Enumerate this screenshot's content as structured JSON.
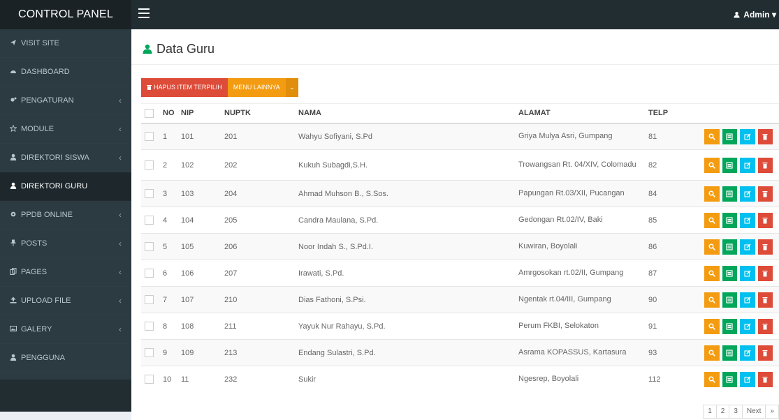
{
  "app": {
    "brand": "CONTROL PANEL",
    "user": "Admin"
  },
  "sidebar": {
    "items": [
      {
        "label": "VISIT SITE",
        "icon": "send-icon",
        "chevron": false
      },
      {
        "label": "DASHBOARD",
        "icon": "dashboard-icon",
        "chevron": false
      },
      {
        "label": "PENGATURAN",
        "icon": "cogs-icon",
        "chevron": true
      },
      {
        "label": "MODULE",
        "icon": "star-icon",
        "chevron": true
      },
      {
        "label": "DIREKTORI SISWA",
        "icon": "user-icon",
        "chevron": true
      },
      {
        "label": "DIREKTORI GURU",
        "icon": "user-icon",
        "chevron": false,
        "active": true
      },
      {
        "label": "PPDB ONLINE",
        "icon": "gear-icon",
        "chevron": true
      },
      {
        "label": "POSTS",
        "icon": "pushpin-icon",
        "chevron": true
      },
      {
        "label": "PAGES",
        "icon": "pages-icon",
        "chevron": true
      },
      {
        "label": "UPLOAD FILE",
        "icon": "upload-icon",
        "chevron": true
      },
      {
        "label": "GALERY",
        "icon": "image-icon",
        "chevron": true
      },
      {
        "label": "PENGGUNA",
        "icon": "user-icon",
        "chevron": false
      }
    ],
    "chevron_glyph": "‹"
  },
  "page": {
    "title": "Data Guru"
  },
  "toolbar": {
    "delete_label": "HAPUS ITEM TERPILIH",
    "more_label": "MENU LAINNYA",
    "caret": "⌄"
  },
  "table": {
    "headers": {
      "no": "NO",
      "nip": "NIP",
      "nuptk": "NUPTK",
      "nama": "NAMA",
      "alamat": "ALAMAT",
      "telp": "TELP"
    },
    "rows": [
      {
        "no": "1",
        "nip": "101",
        "nuptk": "201",
        "nama": "Wahyu Sofiyani, S.Pd",
        "alamat": "Griya Mulya Asri, Gumpang",
        "telp": "81"
      },
      {
        "no": "2",
        "nip": "102",
        "nuptk": "202",
        "nama": "Kukuh Subagdi,S.H.",
        "alamat": "Trowangsan Rt. 04/XIV, Colomadu",
        "telp": "82"
      },
      {
        "no": "3",
        "nip": "103",
        "nuptk": "204",
        "nama": "Ahmad Muhson B., S.Sos.",
        "alamat": "Papungan Rt.03/XII, Pucangan",
        "telp": "84"
      },
      {
        "no": "4",
        "nip": "104",
        "nuptk": "205",
        "nama": "Candra Maulana, S.Pd.",
        "alamat": "Gedongan Rt.02/IV, Baki",
        "telp": "85"
      },
      {
        "no": "5",
        "nip": "105",
        "nuptk": "206",
        "nama": "Noor Indah S., S.Pd.I.",
        "alamat": "Kuwiran, Boyolali",
        "telp": "86"
      },
      {
        "no": "6",
        "nip": "106",
        "nuptk": "207",
        "nama": "Irawati, S.Pd.",
        "alamat": "Amrgosokan rt.02/II, Gumpang",
        "telp": "87"
      },
      {
        "no": "7",
        "nip": "107",
        "nuptk": "210",
        "nama": "Dias Fathoni, S.Psi.",
        "alamat": "Ngentak rt.04/III, Gumpang",
        "telp": "90"
      },
      {
        "no": "8",
        "nip": "108",
        "nuptk": "211",
        "nama": "Yayuk Nur Rahayu, S.Pd.",
        "alamat": "Perum FKBI, Selokaton",
        "telp": "91"
      },
      {
        "no": "9",
        "nip": "109",
        "nuptk": "213",
        "nama": "Endang Sulastri, S.Pd.",
        "alamat": "Asrama KOPASSUS, Kartasura",
        "telp": "93"
      },
      {
        "no": "10",
        "nip": "11",
        "nuptk": "232",
        "nama": "Sukir",
        "alamat": "Ngesrep, Boyolali",
        "telp": "112"
      }
    ],
    "actions": [
      {
        "name": "view-button",
        "icon": "search-icon",
        "color": "#f39c12"
      },
      {
        "name": "detail-button",
        "icon": "list-icon",
        "color": "#00a65a"
      },
      {
        "name": "edit-button",
        "icon": "edit-icon",
        "color": "#00c0ef"
      },
      {
        "name": "delete-button",
        "icon": "trash-icon",
        "color": "#dd4b39"
      }
    ]
  },
  "pagination": [
    "1",
    "2",
    "3",
    "Next",
    "»"
  ],
  "colors": {
    "topbar": "#222d32",
    "sidebar": "#2c3b41",
    "active": "#1e282c",
    "red": "#dd4b39",
    "yellow": "#f39c12",
    "green": "#00a65a",
    "cyan": "#00c0ef"
  }
}
